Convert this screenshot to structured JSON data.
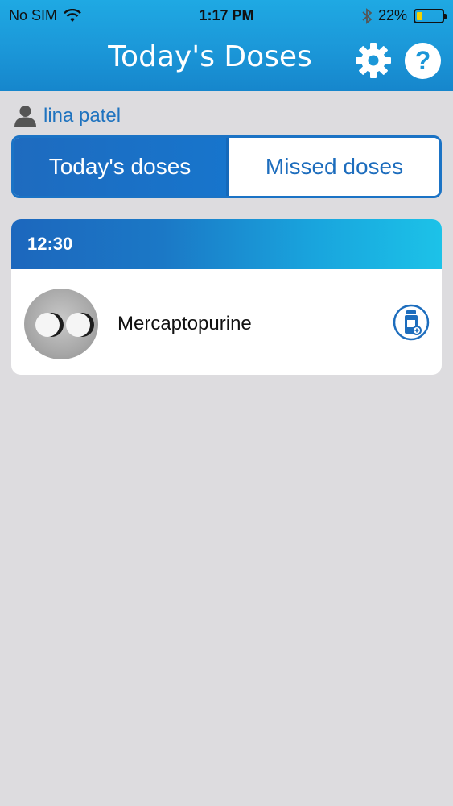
{
  "status_bar": {
    "carrier": "No SIM",
    "time": "1:17 PM",
    "battery": "22%",
    "battery_level": 0.22,
    "icons": [
      "wifi-icon",
      "bluetooth-icon",
      "battery-icon"
    ]
  },
  "header": {
    "title": "Today's Doses",
    "settings_icon": "gear-icon",
    "help_icon": "help-icon",
    "help_glyph": "?"
  },
  "user": {
    "name": "lina patel",
    "icon": "user-icon"
  },
  "tabs": {
    "active_label": "Today's doses",
    "inactive_label": "Missed doses"
  },
  "doses": [
    {
      "time": "12:30",
      "medication": "Mercaptopurine",
      "image_icon": "pill-photo",
      "action_icon": "refill-bottle-icon"
    }
  ],
  "colors": {
    "header_blue": "#1b97d8",
    "accent_blue": "#1b73c5",
    "background": "#dddcdf"
  }
}
